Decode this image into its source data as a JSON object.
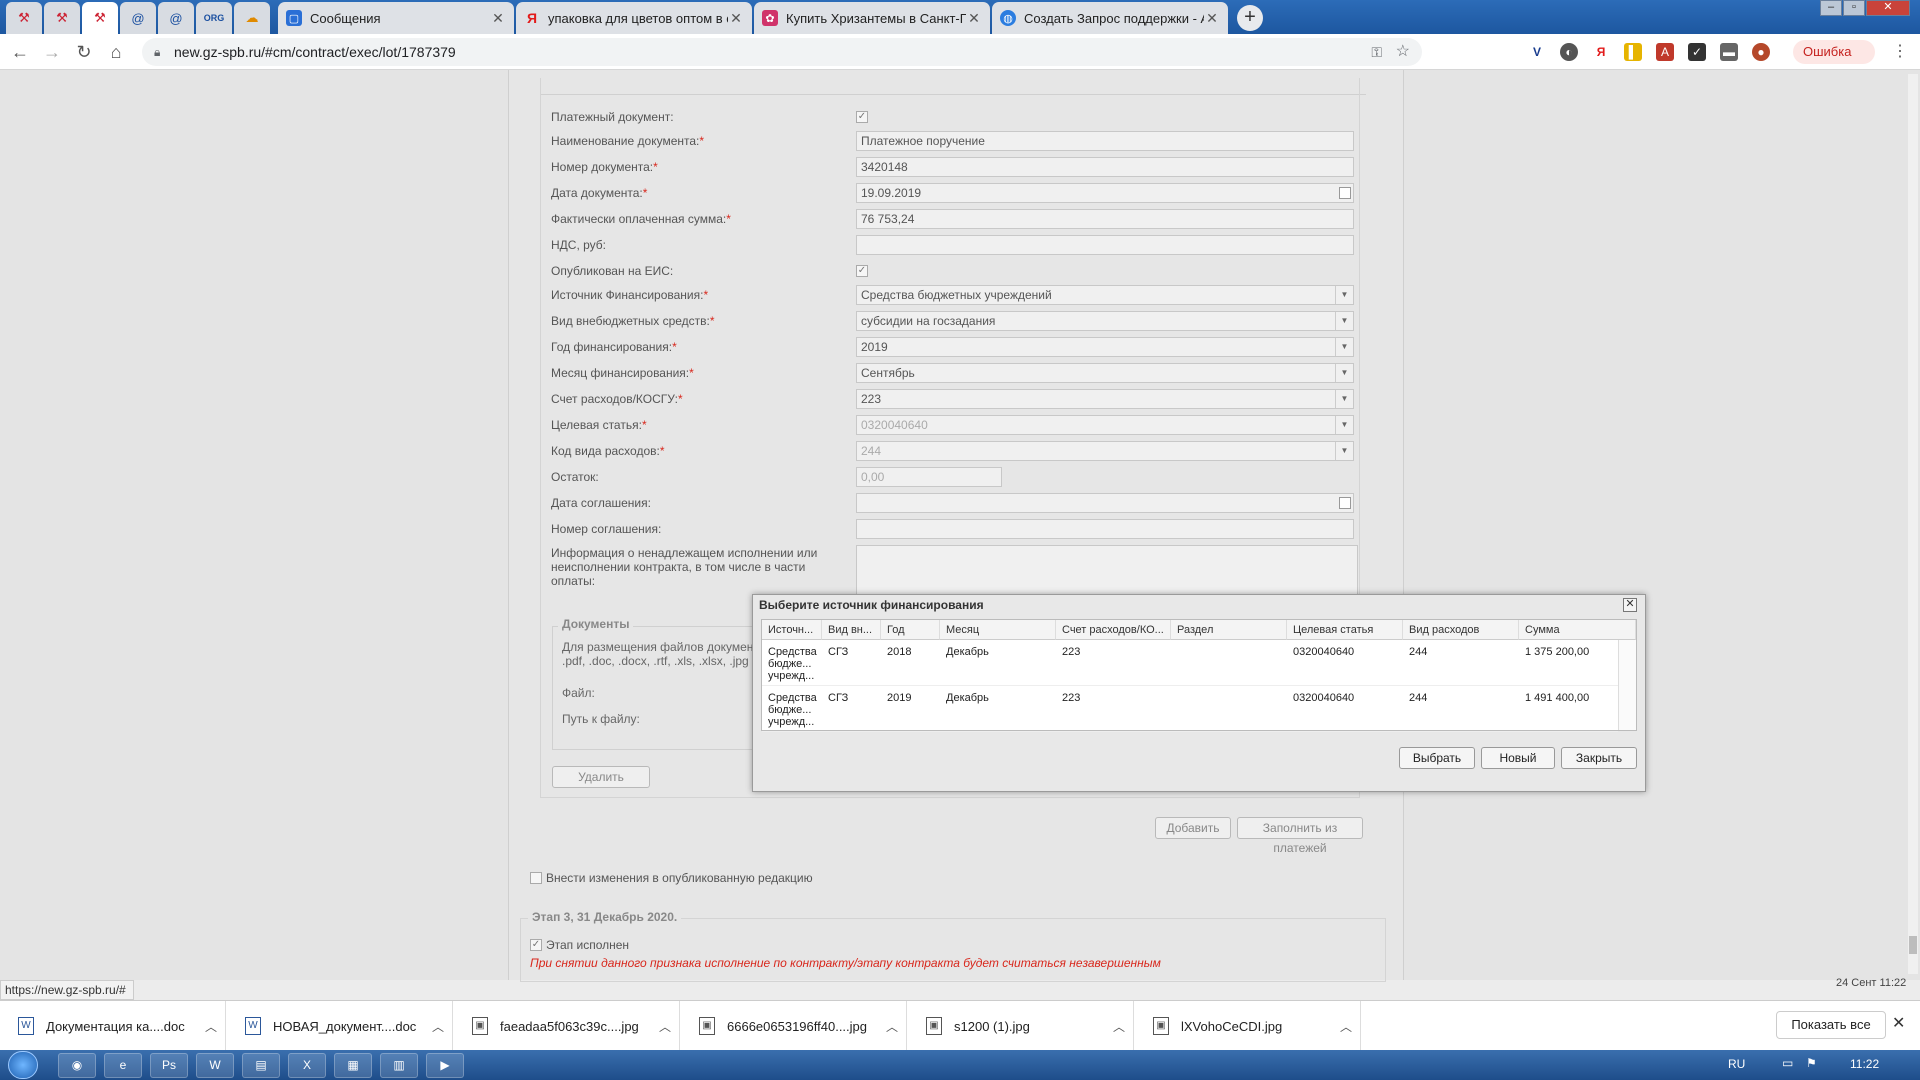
{
  "browser": {
    "pinned_tabs": [
      {
        "icon": "gavel-icon",
        "glyph": "⚒"
      },
      {
        "icon": "gavel-icon",
        "glyph": "⚒"
      },
      {
        "icon": "gavel-icon",
        "glyph": "⚒"
      },
      {
        "icon": "at-icon",
        "glyph": "@"
      },
      {
        "icon": "at-icon",
        "glyph": "@"
      },
      {
        "icon": "org-icon",
        "glyph": "ORG"
      },
      {
        "icon": "cloud-icon",
        "glyph": "☁"
      }
    ],
    "tabs": [
      {
        "title": "Сообщения",
        "icon": "chat-icon"
      },
      {
        "title": "упаковка для цветов оптом в сп",
        "icon": "yandex-icon"
      },
      {
        "title": "Купить Хризантемы в Санкт-Пе",
        "icon": "flower-icon"
      },
      {
        "title": "Создать Запрос поддержки - Al",
        "icon": "globe-icon"
      }
    ],
    "url": "new.gz-spb.ru/#cm/contract/exec/lot/1787379",
    "error_label": "Ошибка",
    "status_url": "https://new.gz-spb.ru/#",
    "date_overlay": "24 Сент 11:22"
  },
  "form": {
    "fields": [
      {
        "label": "Платежный документ:",
        "required": false,
        "type": "checkbox",
        "checked": true
      },
      {
        "label": "Наименование документа:",
        "required": true,
        "type": "text",
        "value": "Платежное поручение"
      },
      {
        "label": "Номер документа:",
        "required": true,
        "type": "text",
        "value": "3420148"
      },
      {
        "label": "Дата документа:",
        "required": true,
        "type": "date",
        "value": "19.09.2019"
      },
      {
        "label": "Фактически оплаченная сумма:",
        "required": true,
        "type": "text",
        "value": "76 753,24"
      },
      {
        "label": "НДС, руб:",
        "required": false,
        "type": "text",
        "value": ""
      },
      {
        "label": "Опубликован на ЕИС:",
        "required": false,
        "type": "checkbox",
        "checked": true
      },
      {
        "label": "Источник Финансирования:",
        "required": true,
        "type": "select",
        "value": "Средства бюджетных учреждений"
      },
      {
        "label": "Вид внебюджетных средств:",
        "required": true,
        "type": "select",
        "value": "субсидии на госзадания"
      },
      {
        "label": "Год финансирования:",
        "required": true,
        "type": "select",
        "value": "2019"
      },
      {
        "label": "Месяц финансирования:",
        "required": true,
        "type": "select",
        "value": "Сентябрь"
      },
      {
        "label": "Счет расходов/КОСГУ:",
        "required": true,
        "type": "select",
        "value": "223"
      },
      {
        "label": "Целевая статья:",
        "required": true,
        "type": "select-disabled",
        "value": "0320040640"
      },
      {
        "label": "Код вида расходов:",
        "required": true,
        "type": "select-disabled",
        "value": "244"
      },
      {
        "label": "Остаток:",
        "required": false,
        "type": "short-disabled",
        "value": "0,00"
      },
      {
        "label": "Дата соглашения:",
        "required": false,
        "type": "date",
        "value": ""
      },
      {
        "label": "Номер соглашения:",
        "required": false,
        "type": "text",
        "value": ""
      }
    ],
    "info_label": "Информация о ненадлежащем исполнении или неисполнении контракта, в том числе в части оплаты:",
    "documents": {
      "legend": "Документы",
      "hint_line1": "Для размещения файлов документ",
      "hint_line2": ".pdf, .doc, .docx, .rtf, .xls, .xlsx, .jpg",
      "file_label": "Файл:",
      "path_label": "Путь к файлу:"
    },
    "delete_button": "Удалить",
    "add_button": "Добавить",
    "fill_button": "Заполнить из платежей",
    "amend_checkbox_label": "Внести изменения в опубликованную редакцию",
    "stage_title": "Этап 3, 31 Декабрь 2020.",
    "stage_done_label": "Этап исполнен",
    "stage_warning": "При снятии данного признака исполнение по контракту/этапу контракта будет считаться незавершенным"
  },
  "modal": {
    "title": "Выберите источник финансирования",
    "columns": [
      "Источн...",
      "Вид вн...",
      "Год",
      "Месяц",
      "Счет расходов/КО...",
      "Раздел",
      "Целевая статья",
      "Вид расходов",
      "Сумма"
    ],
    "rows": [
      {
        "source": "Средства бюдже... учрежд...",
        "kind": "СГЗ",
        "year": "2018",
        "month": "Декабрь",
        "account": "223",
        "section": "",
        "article": "0320040640",
        "expense": "244",
        "sum": "1 375 200,00"
      },
      {
        "source": "Средства бюдже... учрежд...",
        "kind": "СГЗ",
        "year": "2019",
        "month": "Декабрь",
        "account": "223",
        "section": "",
        "article": "0320040640",
        "expense": "244",
        "sum": "1 491 400,00"
      }
    ],
    "buttons": {
      "select": "Выбрать",
      "new": "Новый",
      "close": "Закрыть"
    }
  },
  "downloads": {
    "items": [
      {
        "name": "Документация ка....doc",
        "icon": "word-doc-icon"
      },
      {
        "name": "НОВАЯ_документ....doc",
        "icon": "word-doc-icon"
      },
      {
        "name": "faeadaa5f063c39c....jpg",
        "icon": "image-file-icon"
      },
      {
        "name": "6666e0653196ff40....jpg",
        "icon": "image-file-icon"
      },
      {
        "name": "s1200 (1).jpg",
        "icon": "image-file-icon"
      },
      {
        "name": "lXVohoCeCDI.jpg",
        "icon": "image-file-icon"
      }
    ],
    "show_all": "Показать все"
  },
  "taskbar": {
    "lang": "RU",
    "time": "11:22"
  }
}
